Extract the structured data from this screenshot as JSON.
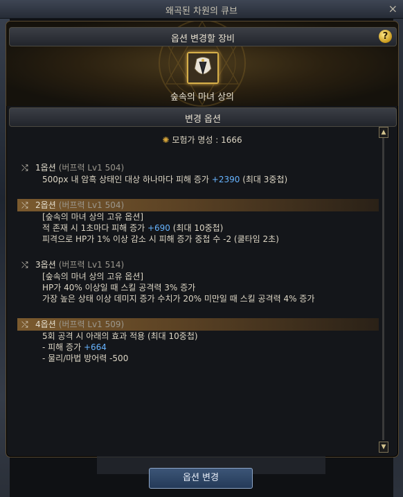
{
  "window": {
    "title": "왜곡된 차원의 큐브",
    "close_glyph": "×"
  },
  "header": {
    "title": "옵션 변경할 장비",
    "help_glyph": "?"
  },
  "item": {
    "name": "숲속의 마녀 상의"
  },
  "section": {
    "title": "변경 옵션"
  },
  "fame": {
    "label": "모험가 명성 : 1666"
  },
  "options": [
    {
      "label": "1옵션",
      "sub": "(버프력 Lv1 504)",
      "active": false,
      "lines": [
        [
          {
            "t": "500px 내 암흑 상태인 대상 하나마다 피해 증가 "
          },
          {
            "t": "+2390",
            "hl": true
          },
          {
            "t": " (최대 3중첩)"
          }
        ]
      ]
    },
    {
      "label": "2옵션",
      "sub": "(버프력 Lv1 504)",
      "active": true,
      "lines": [
        [
          {
            "t": "[숲속의 마녀 상의 고유 옵션]"
          }
        ],
        [
          {
            "t": "적 존재 시 1초마다 피해 증가 "
          },
          {
            "t": "+690",
            "hl": true
          },
          {
            "t": " (최대 10중첩)"
          }
        ],
        [
          {
            "t": "피격으로 HP가 1% 이상 감소 시 피해 증가 중첩 수 -2 (쿨타임 2초)"
          }
        ]
      ]
    },
    {
      "label": "3옵션",
      "sub": "(버프력 Lv1 514)",
      "active": false,
      "lines": [
        [
          {
            "t": "[숲속의 마녀 상의 고유 옵션]"
          }
        ],
        [
          {
            "t": "HP가 40% 이상일 때 스킬 공격력 3% 증가"
          }
        ],
        [
          {
            "t": "가장 높은 상태 이상 데미지 증가 수치가 20% 미만일 때 스킬 공격력 4% 증가"
          }
        ]
      ]
    },
    {
      "label": "4옵션",
      "sub": "(버프력 Lv1 509)",
      "active": true,
      "lines": [
        [
          {
            "t": "5회 공격 시 아래의 효과 적용 (최대 10중첩)"
          }
        ],
        [
          {
            "t": "- 피해 증가 "
          },
          {
            "t": "+664",
            "hl": true
          }
        ],
        [
          {
            "t": "- 물리/마법 방어력 -500"
          }
        ]
      ]
    }
  ],
  "footer": {
    "change_button": "옵션 변경"
  },
  "colors": {
    "highlight": "#67b4ff",
    "active_row": "#7b5a2e",
    "gold": "#d7b04a"
  }
}
